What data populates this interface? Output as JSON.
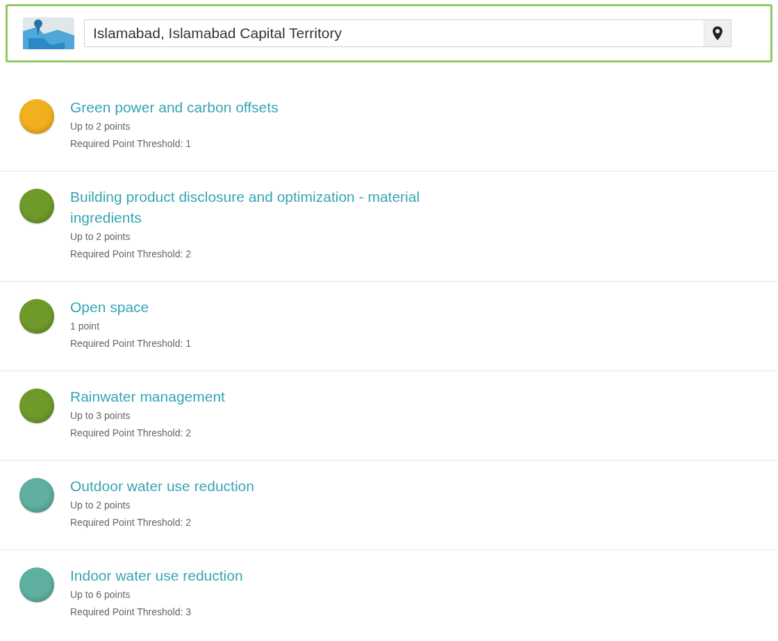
{
  "location": {
    "value": "Islamabad, Islamabad Capital Territory"
  },
  "credits": [
    {
      "title": "Green power and carbon offsets",
      "points": "Up to 2 points",
      "threshold": "Required Point Threshold: 1",
      "color": "#f2b01e"
    },
    {
      "title": "Building product disclosure and optimization - material ingredients",
      "points": "Up to 2 points",
      "threshold": "Required Point Threshold: 2",
      "color": "#6f9a2a"
    },
    {
      "title": "Open space",
      "points": "1 point",
      "threshold": "Required Point Threshold: 1",
      "color": "#6f9a2a"
    },
    {
      "title": "Rainwater management",
      "points": "Up to 3 points",
      "threshold": "Required Point Threshold: 2",
      "color": "#6f9a2a"
    },
    {
      "title": "Outdoor water use reduction",
      "points": "Up to 2 points",
      "threshold": "Required Point Threshold: 2",
      "color": "#5fb0a0"
    },
    {
      "title": "Indoor water use reduction",
      "points": "Up to 6 points",
      "threshold": "Required Point Threshold: 3",
      "color": "#5fb0a0"
    }
  ]
}
